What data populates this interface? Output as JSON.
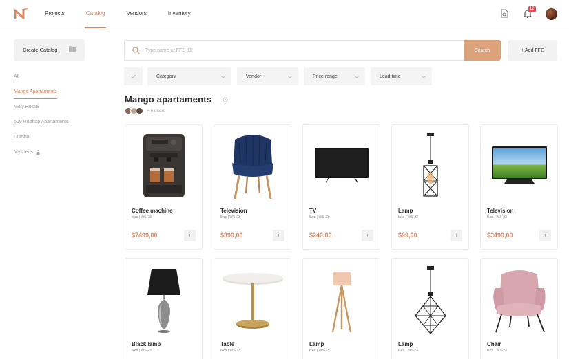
{
  "nav": {
    "items": [
      {
        "label": "Projects",
        "active": false
      },
      {
        "label": "Catalog",
        "active": true
      },
      {
        "label": "Vendors",
        "active": false
      },
      {
        "label": "Inventory",
        "active": false
      }
    ],
    "notification_count": "12"
  },
  "sidebar": {
    "create_label": "Create Catalog",
    "items": [
      {
        "label": "All",
        "active": false
      },
      {
        "label": "Mango Apartaments",
        "active": true
      },
      {
        "label": "Moly Hostel",
        "active": false
      },
      {
        "label": "609 Rooftop Apartaments",
        "active": false
      },
      {
        "label": "Dumbo",
        "active": false
      },
      {
        "label": "My ideas",
        "active": false,
        "locked": true
      }
    ]
  },
  "search": {
    "placeholder": "Type name or FFE ID",
    "value": "",
    "button_label": "Search",
    "add_label": "+ Add FFE"
  },
  "filters": [
    "Category",
    "Vendor",
    "Price range",
    "Lead time"
  ],
  "catalog": {
    "title": "Mango apartaments",
    "users_text": "+ 6 users"
  },
  "accent_color": "#d08a67",
  "products_row1": [
    {
      "name": "Coffee machine",
      "meta": "Ikea  |  WS-23",
      "price": "$7499,00",
      "image": "coffee-machine"
    },
    {
      "name": "Television",
      "meta": "Ikea  |  WS-23",
      "price": "$399,00",
      "image": "blue-armchair"
    },
    {
      "name": "TV",
      "meta": "Ikea  |  WS-23",
      "price": "$249,00",
      "image": "tv-black"
    },
    {
      "name": "Lamp",
      "meta": "Ikea  |  WS-23",
      "price": "$99,00",
      "image": "pendant-cage-lamp"
    },
    {
      "name": "Television",
      "meta": "Ikea  |  WS-23",
      "price": "$3499,00",
      "image": "tv-landscape"
    }
  ],
  "products_row2": [
    {
      "name": "Black lamp",
      "meta": "Ikea  |  WS-23",
      "image": "black-table-lamp"
    },
    {
      "name": "Table",
      "meta": "Ikea  |  WS-23",
      "image": "marble-round-table"
    },
    {
      "name": "Lamp",
      "meta": "Ikea  |  WS-23",
      "image": "tripod-floor-lamp"
    },
    {
      "name": "Lamp",
      "meta": "Ikea  |  WS-23",
      "image": "geometric-pendant-lamp"
    },
    {
      "name": "Chair",
      "meta": "Ikea  |  WS-23",
      "image": "pink-armchair"
    }
  ],
  "add_to_catalog_label": "+"
}
